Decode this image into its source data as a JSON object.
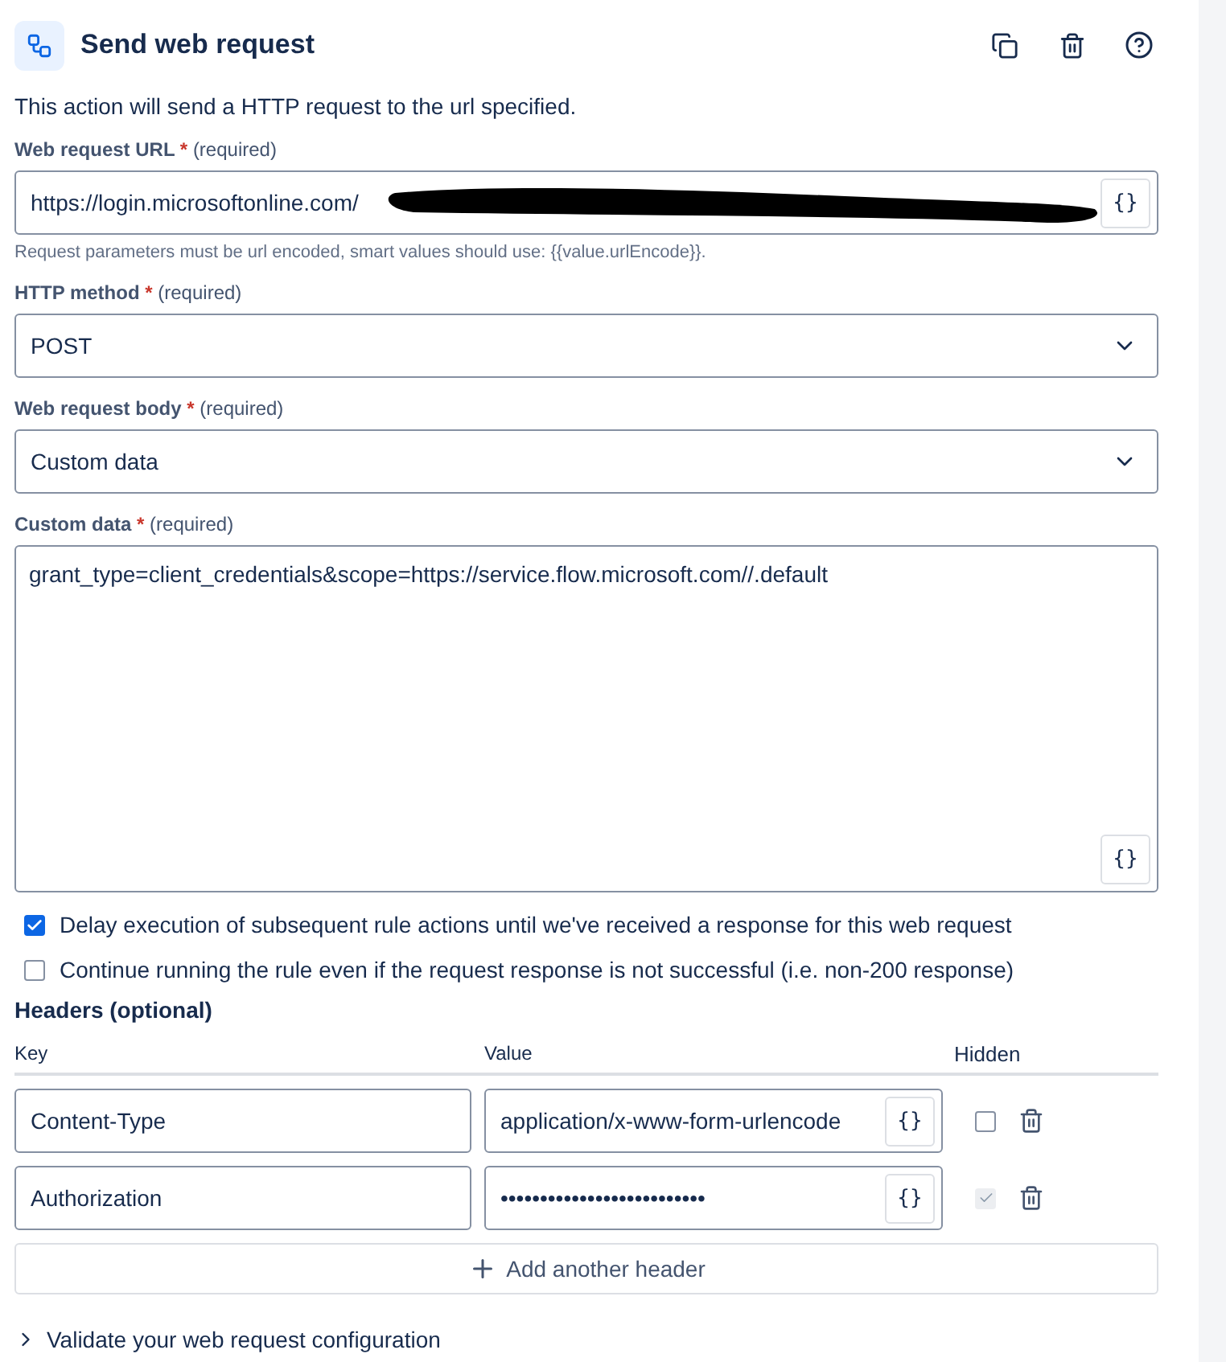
{
  "header": {
    "title": "Send web request"
  },
  "description": "This action will send a HTTP request to the url specified.",
  "url_field": {
    "label": "Web request URL",
    "required_mark": "*",
    "required": "(required)",
    "value": "https://login.microsoftonline.com/",
    "redacted": true,
    "smart_button": "{}",
    "hint": "Request parameters must be url encoded, smart values should use: {{value.urlEncode}}."
  },
  "method_field": {
    "label": "HTTP method",
    "required_mark": "*",
    "required": "(required)",
    "value": "POST"
  },
  "body_field": {
    "label": "Web request body",
    "required_mark": "*",
    "required": "(required)",
    "value": "Custom data"
  },
  "custom_data": {
    "label": "Custom data",
    "required_mark": "*",
    "required": "(required)",
    "value": "grant_type=client_credentials&scope=https://service.flow.microsoft.com//.default",
    "smart_button": "{}"
  },
  "options": [
    {
      "label": "Delay execution of subsequent rule actions until we've received a response for this web request",
      "checked": true
    },
    {
      "label": "Continue running the rule even if the request response is not successful (i.e. non-200 response)",
      "checked": false
    }
  ],
  "headers": {
    "title": "Headers (optional)",
    "columns": [
      "Key",
      "Value",
      "Hidden"
    ],
    "rows": [
      {
        "key": "Content-Type",
        "value": "application/x-www-form-urlencode",
        "smart_button": "{}",
        "hidden": false
      },
      {
        "key": "Authorization",
        "value": "••••••••••••••••••••••••••",
        "smart_button": "{}",
        "hidden": true
      }
    ],
    "add_button": "Add another header"
  },
  "validate": {
    "label": "Validate your web request configuration",
    "expanded": false
  }
}
